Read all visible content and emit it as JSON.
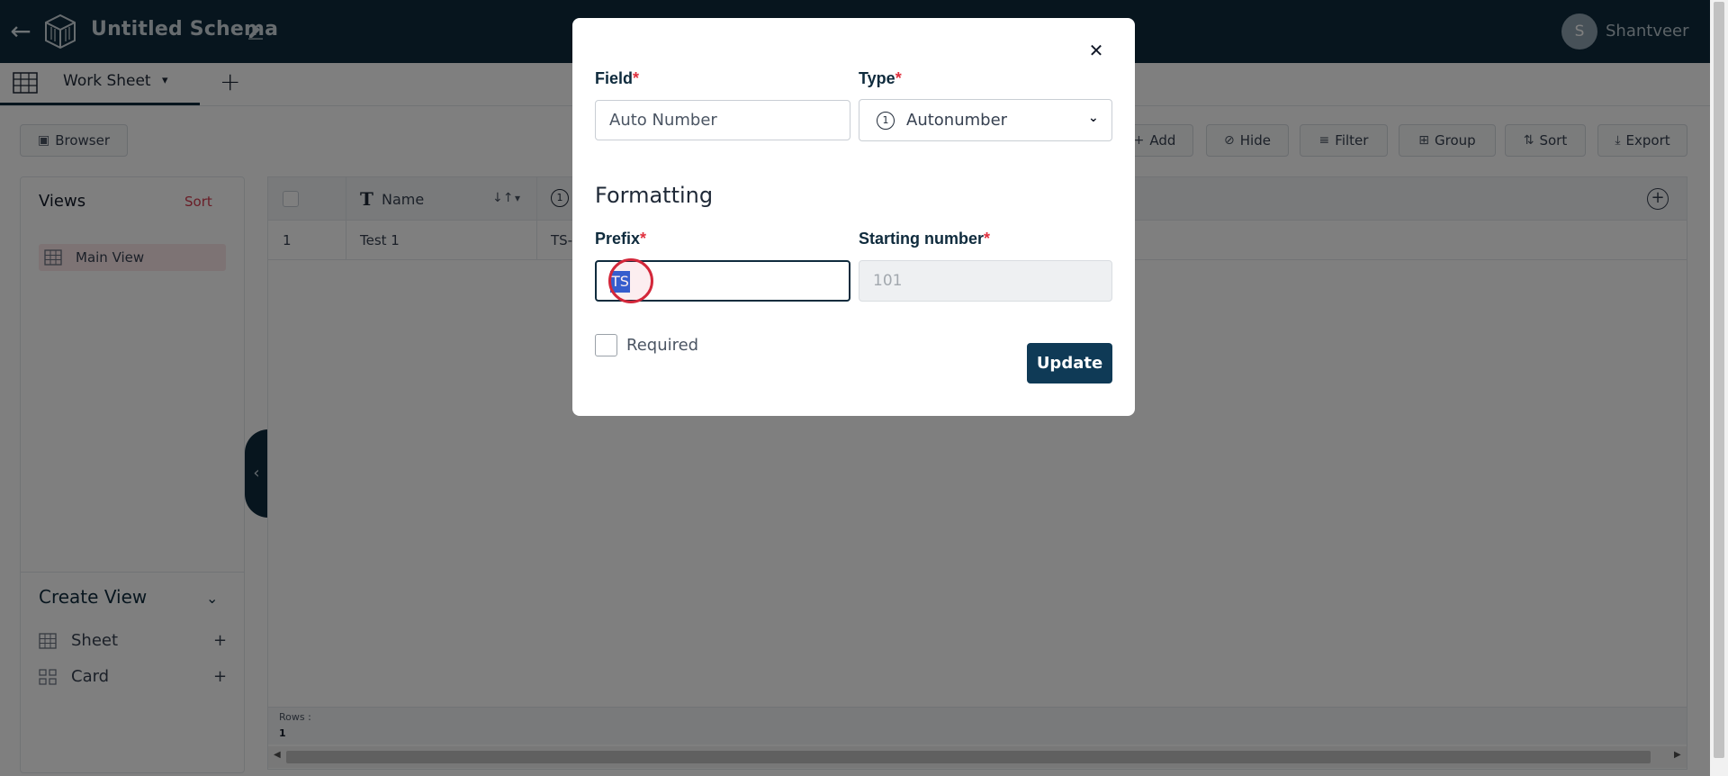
{
  "header": {
    "schema_title": "Untitled Schema",
    "user_initial": "S",
    "user_name": "Shantveer"
  },
  "tabs": {
    "active_label": "Work Sheet",
    "add_symbol": "+"
  },
  "toolbar": {
    "browser": "Browser",
    "add": "Add",
    "hide": "Hide",
    "filter": "Filter",
    "group": "Group",
    "sort": "Sort",
    "export": "Export"
  },
  "sidebar": {
    "views_title": "Views",
    "views_sort": "Sort",
    "main_view": "Main View",
    "create_view_title": "Create View",
    "create_items": [
      {
        "label": "Sheet",
        "plus": "+"
      },
      {
        "label": "Card",
        "plus": "+"
      }
    ]
  },
  "grid": {
    "name_header": "Name",
    "auto_icon": "1",
    "rows": [
      {
        "num": "1",
        "name": "Test 1",
        "auto": "TS-"
      }
    ],
    "footer_rows_label": "Rows :",
    "footer_rows_count": "1"
  },
  "modal": {
    "field_label": "Field",
    "field_value": "Auto Number",
    "type_label": "Type",
    "type_icon": "1",
    "type_value": "Autonumber",
    "section_title": "Formatting",
    "prefix_label": "Prefix",
    "prefix_value": "TS",
    "starting_number_label": "Starting number",
    "starting_number_placeholder": "101",
    "required_label": "Required",
    "update_button": "Update",
    "required_marker": "*"
  },
  "colors": {
    "topbar": "#0f2b3d",
    "accent_red": "#e0303e",
    "update_button": "#0f3a56",
    "selection": "#2962d9"
  }
}
